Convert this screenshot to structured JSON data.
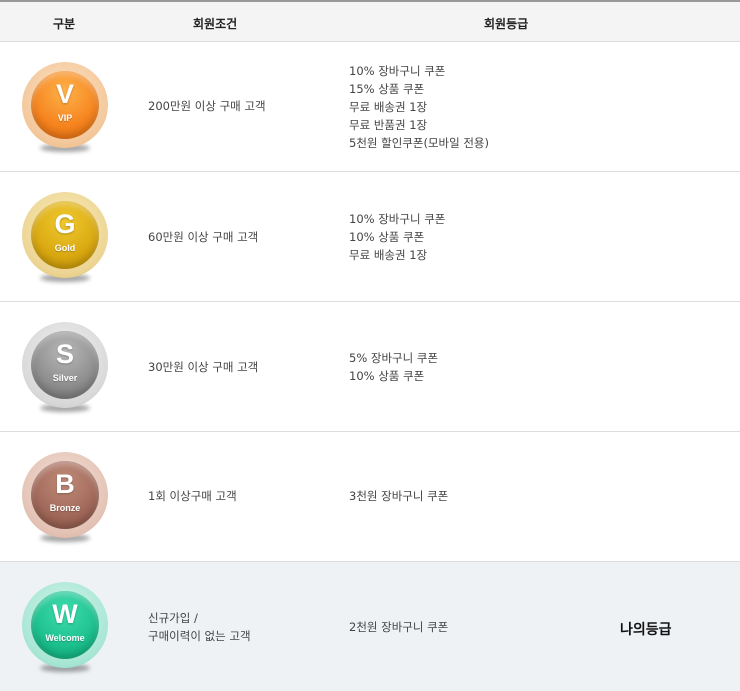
{
  "header": {
    "col_grade": "구분",
    "col_condition": "회원조건",
    "col_benefits": "회원등급"
  },
  "grades": [
    {
      "letter": "V",
      "name": "VIP",
      "condition": [
        "200만원 이상 구매 고객"
      ],
      "benefits": [
        "10% 장바구니 쿠폰",
        "15% 상품 쿠폰",
        "무료 배송권 1장",
        "무료 반품권 1장",
        "5천원 할인쿠폰(모바일 전용)"
      ]
    },
    {
      "letter": "G",
      "name": "Gold",
      "condition": [
        "60만원 이상 구매 고객"
      ],
      "benefits": [
        "10% 장바구니 쿠폰",
        "10% 상품 쿠폰",
        "무료 배송권 1장"
      ]
    },
    {
      "letter": "S",
      "name": "Silver",
      "condition": [
        "30만원 이상 구매 고객"
      ],
      "benefits": [
        "5% 장바구니 쿠폰",
        "10% 상품 쿠폰"
      ]
    },
    {
      "letter": "B",
      "name": "Bronze",
      "condition": [
        "1회 이상구매 고객"
      ],
      "benefits": [
        "3천원 장바구니 쿠폰"
      ]
    },
    {
      "letter": "W",
      "name": "Welcome",
      "condition": [
        "신규가입 /",
        "구매이력이 없는 고객"
      ],
      "benefits": [
        "2천원 장바구니 쿠폰"
      ],
      "my_grade_label": "나의등급"
    }
  ],
  "colors": {
    "vip": "#f5831e",
    "gold": "#d9a810",
    "silver": "#8d8d8d",
    "bronze": "#a0685a",
    "welcome": "#1bbf8c",
    "current_row_bg": "#eef2f5"
  }
}
